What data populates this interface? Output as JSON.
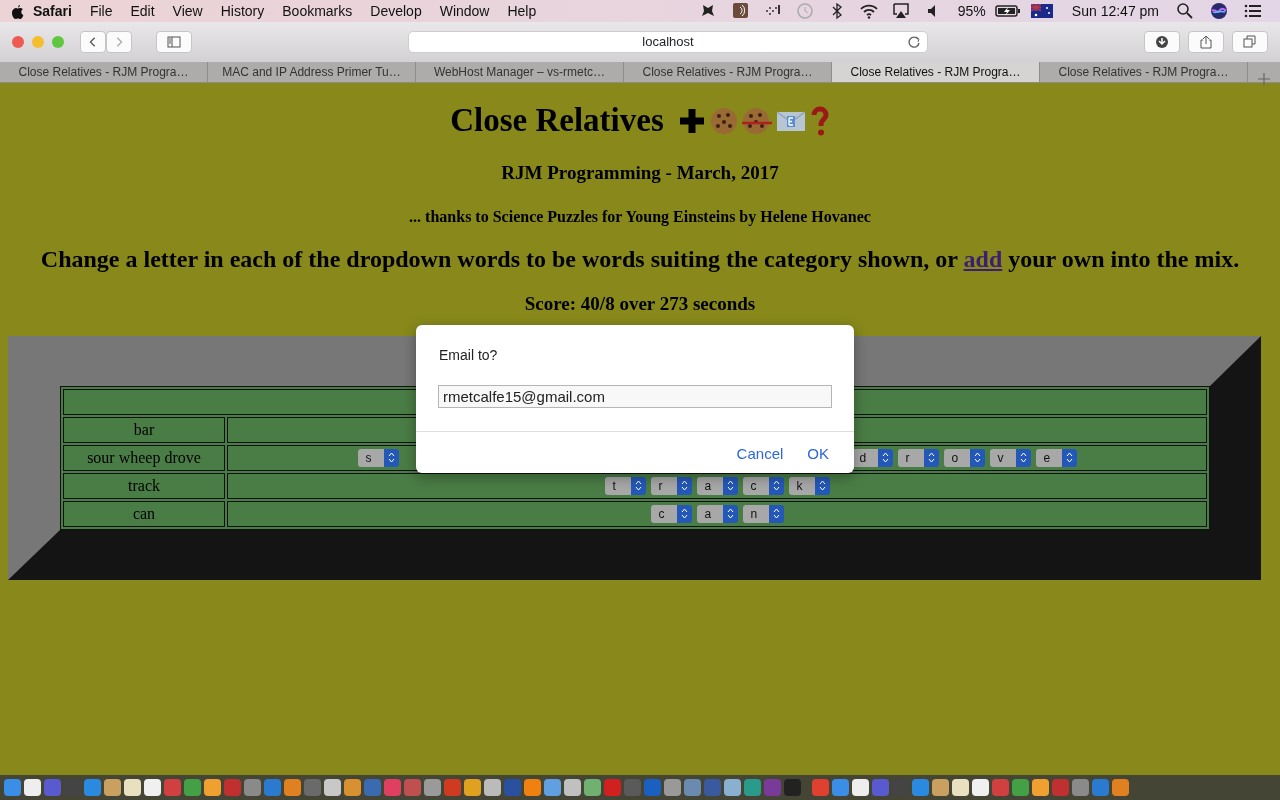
{
  "menu_bar": {
    "app": "Safari",
    "items": [
      "File",
      "Edit",
      "View",
      "History",
      "Bookmarks",
      "Develop",
      "Window",
      "Help"
    ],
    "battery": "95%",
    "clock": "Sun 12:47 pm"
  },
  "toolbar": {
    "address": "localhost"
  },
  "tabs": [
    {
      "label": "Close Relatives - RJM Progra…",
      "selected": false
    },
    {
      "label": "MAC and IP Address Primer Tu…",
      "selected": false
    },
    {
      "label": "WebHost Manager – vs-rmetc…",
      "selected": false
    },
    {
      "label": "Close Relatives - RJM Progra…",
      "selected": false
    },
    {
      "label": "Close Relatives - RJM Progra…",
      "selected": true
    },
    {
      "label": "Close Relatives - RJM Progra…",
      "selected": false
    }
  ],
  "page": {
    "title": "Close Relatives",
    "byline": "RJM Programming - March, 2017",
    "credit": "... thanks to Science Puzzles for Young Einsteins by Helene Hovanec",
    "instructions": {
      "before": "Change a letter in each of the dropdown words to be words suiting the category shown, or ",
      "link": "add",
      "after": " your own into the mix."
    },
    "score": "Score: 40/8 over 273 seconds"
  },
  "puzzle": {
    "rows": [
      {
        "word": "bar"
      },
      {
        "word": "sour wheep drove",
        "letters_left": [
          "s"
        ],
        "letters_right": [
          "d",
          "r",
          "o",
          "v",
          "e"
        ]
      },
      {
        "word": "track",
        "letters": [
          "t",
          "r",
          "a",
          "c",
          "k"
        ]
      },
      {
        "word": "can",
        "letters": [
          "c",
          "a",
          "n"
        ]
      }
    ]
  },
  "dialog": {
    "prompt": "Email to?",
    "value": "rmetcalfe15@gmail.com",
    "buttons": [
      "Cancel",
      "OK"
    ]
  }
}
